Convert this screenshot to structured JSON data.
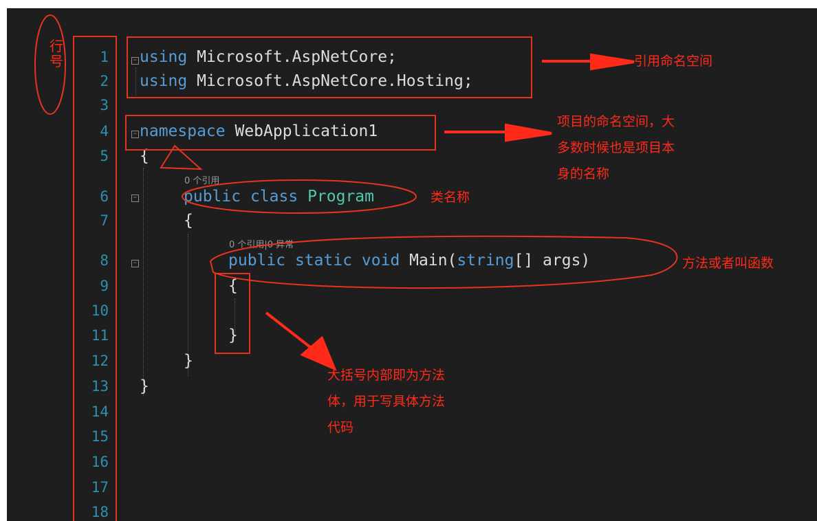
{
  "gutter": {
    "axis_label": "行号",
    "line_numbers": [
      "1",
      "2",
      "3",
      "4",
      "5",
      "6",
      "7",
      "8",
      "9",
      "10",
      "11",
      "12",
      "13",
      "14",
      "15",
      "16",
      "17",
      "18"
    ]
  },
  "code": {
    "line1": {
      "kw": "using",
      "rest": " Microsoft.AspNetCore;"
    },
    "line2": {
      "kw": "using",
      "rest": " Microsoft.AspNetCore.Hosting;"
    },
    "line4": {
      "kw": "namespace",
      "rest": " WebApplication1"
    },
    "line5": "{",
    "line6": {
      "kw1": "public",
      "kw2": "class",
      "type": "Program"
    },
    "line7": "{",
    "line8": {
      "kw1": "public",
      "kw2": "static",
      "kw3": "void",
      "name": "Main(",
      "type": "string",
      "rest": "[] args)"
    },
    "line9": "{",
    "line11": "}",
    "line12": "}",
    "line13": "}"
  },
  "codelens": {
    "class_refs": "0 个引用",
    "method_refs": "0 个引用|0 异常"
  },
  "annotations": {
    "using_note": "引用命名空间",
    "namespace_note": "项目的命名空间，大\n多数时候也是项目本\n身的名称",
    "class_note": "类名称",
    "method_note": "方法或者叫函数",
    "body_note": "大括号内部即为方法\n体，用于写具体方法\n代码"
  },
  "colors": {
    "background": "#1e1e1e",
    "keyword": "#569cd6",
    "type": "#4ec9b0",
    "line_number": "#2b91af",
    "annotation": "#ff2a1a"
  }
}
